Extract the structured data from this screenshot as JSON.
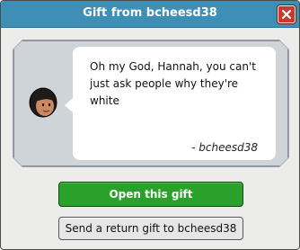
{
  "window": {
    "title": "Gift from bcheesd38",
    "close_icon": "close-icon"
  },
  "message": {
    "text": "Oh my God, Hannah, you can't just ask people why they're white",
    "signature": "- bcheesd38",
    "avatar_icon": "user-avatar-head"
  },
  "actions": {
    "open_label": "Open this gift",
    "return_label": "Send a return gift to bcheesd38"
  },
  "colors": {
    "titlebar": "#3d8fb5",
    "close": "#c8392e",
    "open_button": "#2aa12b",
    "panel": "#cfd4d8"
  }
}
